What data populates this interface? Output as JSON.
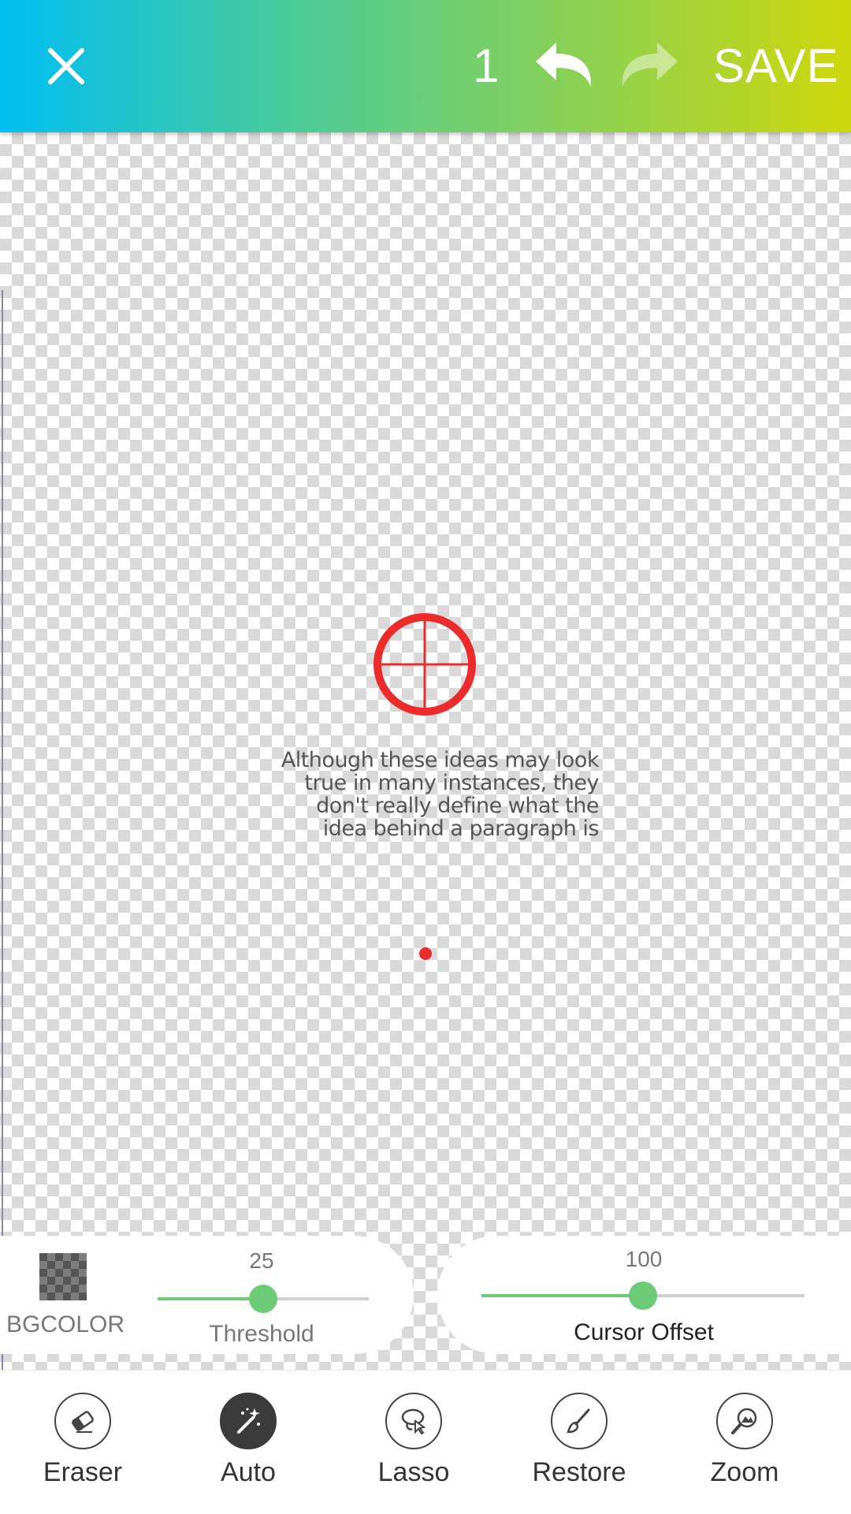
{
  "header": {
    "close_icon": "close-icon",
    "history_count": "1",
    "undo_icon": "undo-icon",
    "redo_icon": "redo-icon",
    "save_label": "SAVE",
    "gradient": [
      "#00bff3",
      "#4ccb98",
      "#8fd14f",
      "#cfd70a"
    ]
  },
  "canvas": {
    "text_lines": [
      "Although these ideas may look",
      "true in many instances, they",
      "don't really define what the",
      "idea behind a paragraph is"
    ],
    "target_color": "#ee2b2b"
  },
  "controls": {
    "bgcolor_label": "BGCOLOR",
    "threshold": {
      "label": "Threshold",
      "value": "25",
      "fraction": 0.5
    },
    "cursor_offset": {
      "label": "Cursor Offset",
      "value": "100",
      "fraction": 0.5
    },
    "accent": "#6bcb77"
  },
  "toolbar": {
    "tools": [
      {
        "label": "Eraser",
        "icon": "eraser-icon",
        "active": false
      },
      {
        "label": "Auto",
        "icon": "magic-wand-icon",
        "active": true
      },
      {
        "label": "Lasso",
        "icon": "lasso-icon",
        "active": false
      },
      {
        "label": "Restore",
        "icon": "brush-icon",
        "active": false
      },
      {
        "label": "Zoom",
        "icon": "zoom-icon",
        "active": false
      }
    ]
  }
}
